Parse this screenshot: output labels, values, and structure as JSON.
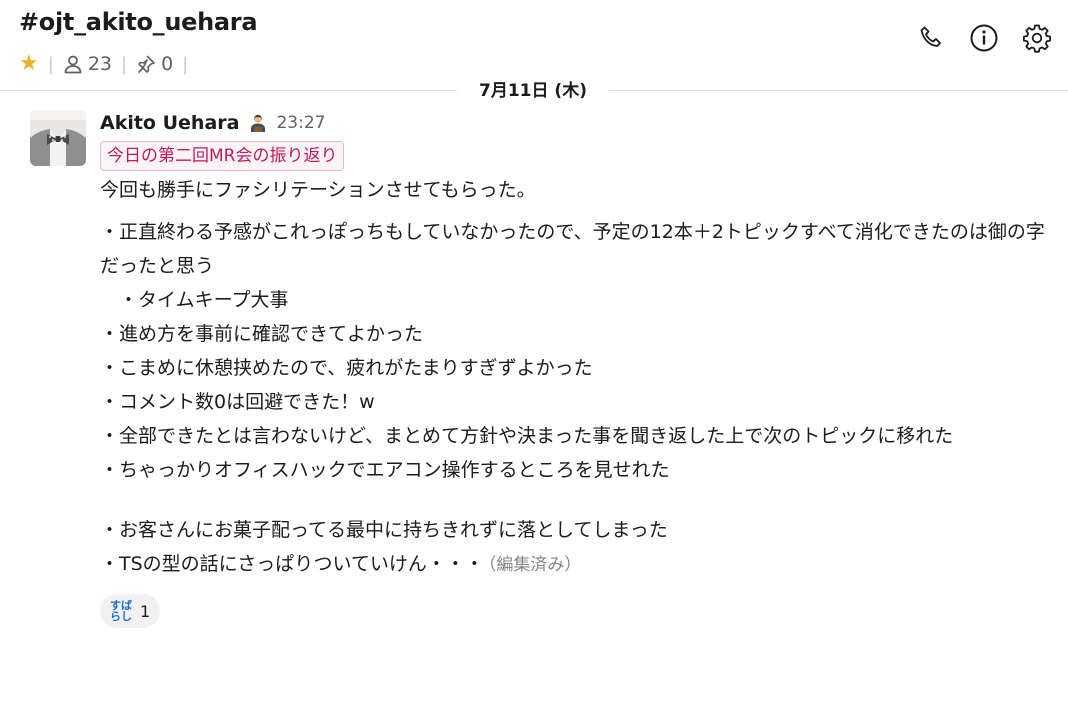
{
  "channel": {
    "title": "#ojt_akito_uehara",
    "members_count": "23",
    "pins_count": "0"
  },
  "header_actions": {
    "call": "phone-icon",
    "details": "info-icon",
    "settings": "gear-icon"
  },
  "date_divider": "7月11日 (木)",
  "message": {
    "author": "Akito Uehara",
    "status_icon": "briefcase-person-icon",
    "time": "23:27",
    "tag": "今日の第二回MR会の振り返り",
    "intro": "今回も勝手にファシリテーションさせてもらった。",
    "lines": [
      "・正直終わる予感がこれっぽっちもしていなかったので、予定の12本＋2トピックすべて消化できたのは御の字だったと思う",
      "　・タイムキープ大事",
      "・進め方を事前に確認できてよかった",
      "・こまめに休憩挟めたので、疲れがたまりすぎずよかった",
      "・コメント数0は回避できた！w",
      "・全部できたとは言わないけど、まとめて方針や決まった事を聞き返した上で次のトピックに移れた",
      "・ちゃっかりオフィスハックでエアコン操作するところを見せれた"
    ],
    "lines2": [
      "・お客さんにお菓子配ってる最中に持ちきれずに落としてしまった",
      "・TSの型の話にさっぱりついていけん・・・"
    ],
    "edited": "（編集済み）",
    "reaction": {
      "emoji_text_1": "すば",
      "emoji_text_2": "らし",
      "count": "1"
    }
  },
  "colors": {
    "star": "#ecb22e",
    "tag_text": "#c5195c",
    "tag_bg": "#fbf4f6",
    "reaction_emoji": "#1e6bd6"
  }
}
